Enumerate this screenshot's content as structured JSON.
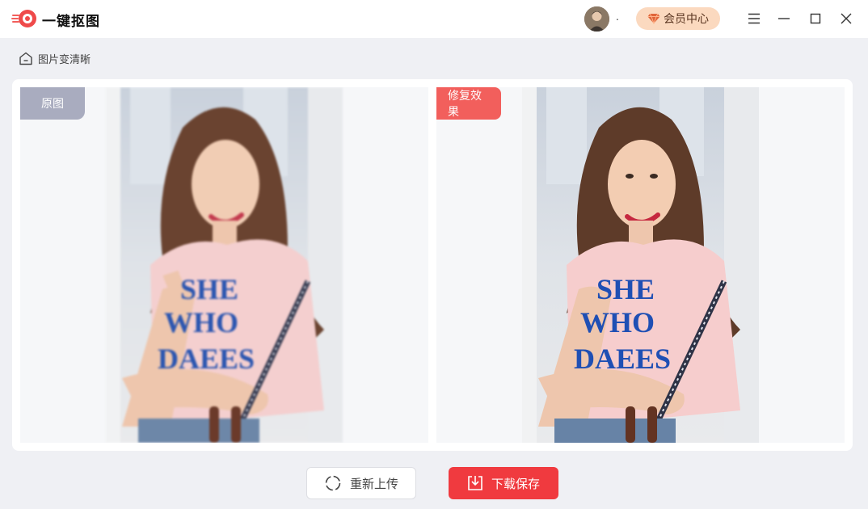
{
  "app": {
    "name": "一键抠图"
  },
  "user": {
    "name": "."
  },
  "header": {
    "vip_label": "会员中心"
  },
  "breadcrumb": {
    "label": "图片变清晰"
  },
  "compare": {
    "original_tag": "原图",
    "result_tag": "修复效果",
    "shirt_text": [
      "SHE",
      "WHO",
      "DAEES"
    ]
  },
  "actions": {
    "reupload_label": "重新上传",
    "save_label": "下载保存"
  },
  "colors": {
    "accent": "#f03a3f",
    "vip_bg": "#fbd9bf",
    "original_tag_bg": "#a9acbf",
    "result_tag_bg": "#f25f5c"
  },
  "icons": {
    "logo": "app-logo-icon",
    "menu": "menu-icon",
    "minimize": "minimize-icon",
    "maximize": "maximize-icon",
    "close": "close-icon",
    "home": "home-icon",
    "vip": "diamond-icon",
    "reupload": "refresh-icon",
    "save": "download-icon"
  }
}
